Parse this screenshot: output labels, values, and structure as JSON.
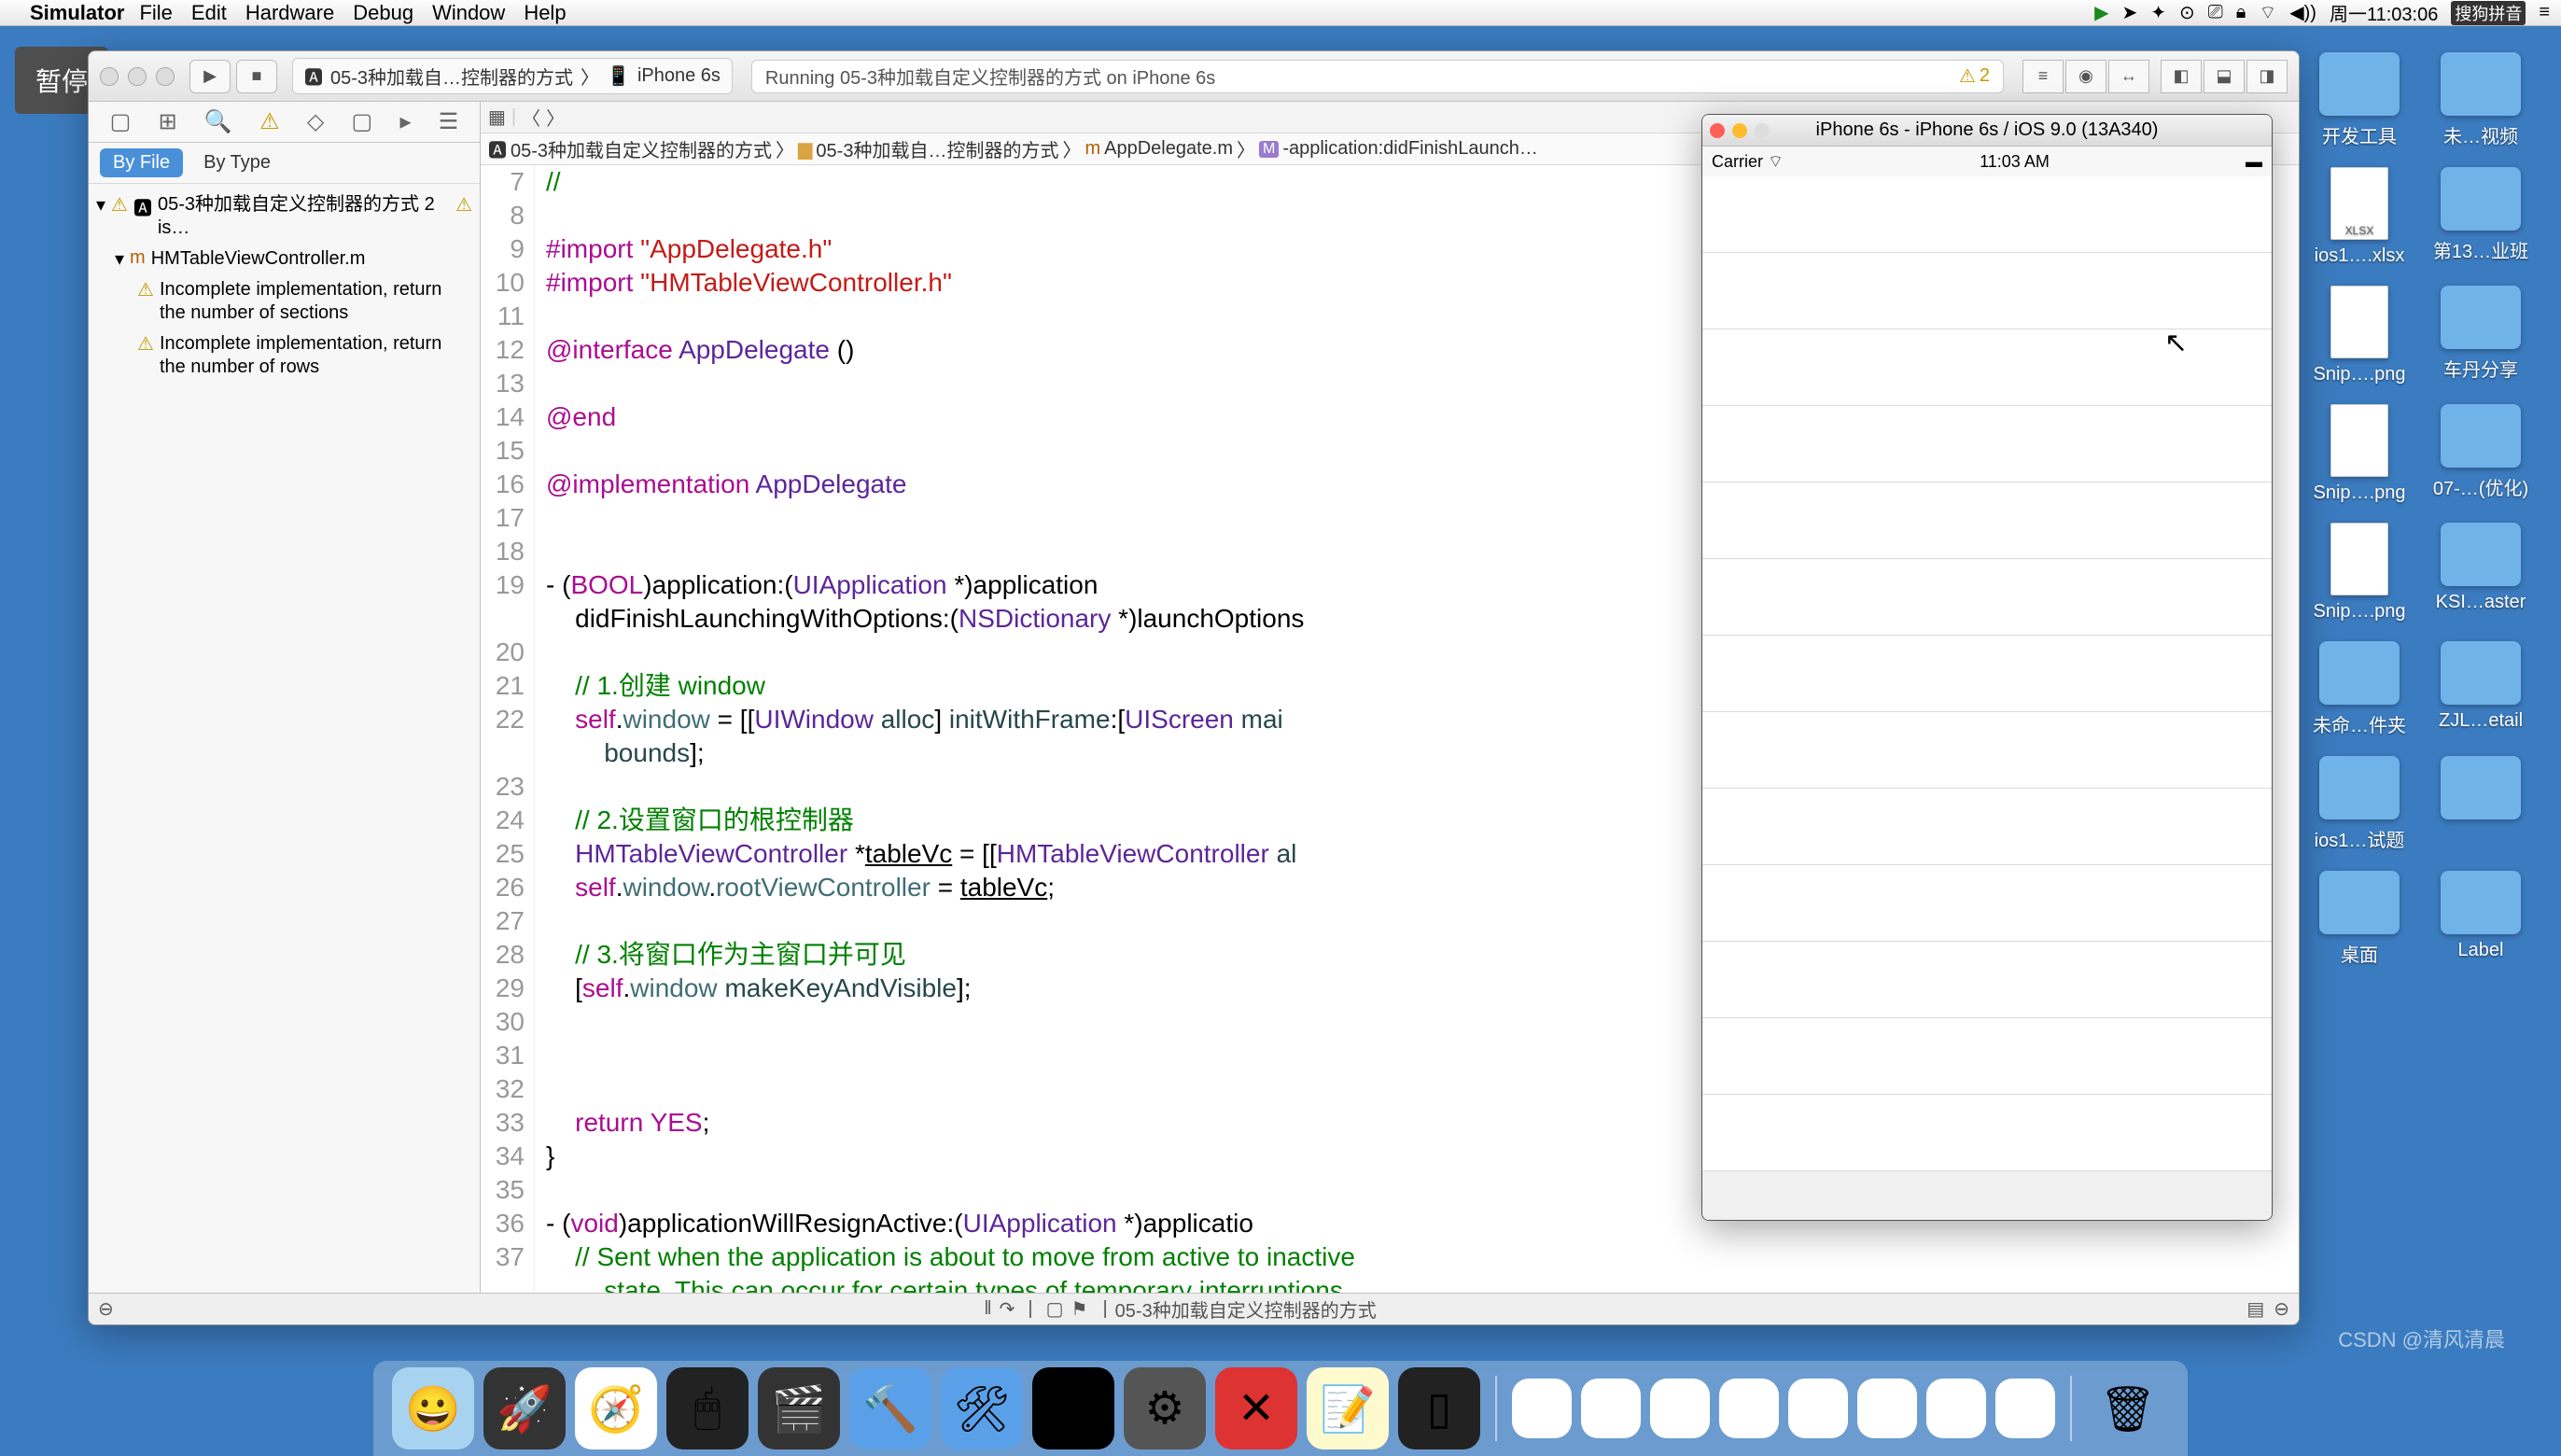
{
  "menubar": {
    "app": "Simulator",
    "menus": [
      "File",
      "Edit",
      "Hardware",
      "Debug",
      "Window",
      "Help"
    ],
    "clock": "周一11:03:06",
    "ime": "搜狗拼音"
  },
  "pause": "暂停",
  "xcode": {
    "scheme_project": "05-3种加载自…控制器的方式",
    "scheme_device": "iPhone 6s",
    "status": "Running 05-3种加载自定义控制器的方式 on iPhone 6s",
    "warn_count": "2",
    "navigator": {
      "filter_byfile": "By File",
      "filter_bytype": "By Type",
      "root": "05-3种加载自定义控制器的方式 2 is…",
      "file": "HMTableViewController.m",
      "issue1": "Incomplete implementation, return the number of sections",
      "issue2": "Incomplete implementation, return the number of rows"
    },
    "breadcrumb": {
      "b1": "05-3种加载自定义控制器的方式",
      "b2": "05-3种加载自…控制器的方式",
      "b3": "AppDelegate.m",
      "b4": "-application:didFinishLaunch…"
    },
    "code": {
      "lines": [
        {
          "n": 7,
          "html": "<span class='c-comment'>//</span>"
        },
        {
          "n": 8,
          "html": ""
        },
        {
          "n": 9,
          "html": "<span class='c-keyword'>#import</span> <span class='c-string'>\"AppDelegate.h\"</span>"
        },
        {
          "n": 10,
          "html": "<span class='c-keyword'>#import</span> <span class='c-string'>\"HMTableViewController.h\"</span>"
        },
        {
          "n": 11,
          "html": ""
        },
        {
          "n": 12,
          "html": "<span class='c-keyword'>@interface</span> <span class='c-type'>AppDelegate</span> ()"
        },
        {
          "n": 13,
          "html": ""
        },
        {
          "n": 14,
          "html": "<span class='c-keyword'>@end</span>"
        },
        {
          "n": 15,
          "html": ""
        },
        {
          "n": 16,
          "html": "<span class='c-keyword'>@implementation</span> <span class='c-type'>AppDelegate</span>"
        },
        {
          "n": 17,
          "html": ""
        },
        {
          "n": 18,
          "html": ""
        },
        {
          "n": 19,
          "html": "- (<span class='c-keyword'>BOOL</span>)application:(<span class='c-type'>UIApplication</span> *)application"
        },
        {
          "n": "",
          "html": "    didFinishLaunchingWithOptions:(<span class='c-type'>NSDictionary</span> *)launchOptions"
        },
        {
          "n": 20,
          "html": ""
        },
        {
          "n": 21,
          "html": "    <span class='c-comment'>// 1.创建 window</span>"
        },
        {
          "n": 22,
          "html": "    <span class='c-self'>self</span>.<span class='c-prop'>window</span> = [[<span class='c-type'>UIWindow</span> <span class='c-method'>alloc</span>] <span class='c-method'>initWithFrame</span>:[<span class='c-type'>UIScreen</span> <span class='c-method'>mai</span>"
        },
        {
          "n": "",
          "html": "        <span class='c-method'>bounds</span>];"
        },
        {
          "n": 23,
          "html": ""
        },
        {
          "n": 24,
          "html": "    <span class='c-comment'>// 2.设置窗口的根控制器</span>"
        },
        {
          "n": 25,
          "html": "    <span class='c-type'>HMTableViewController</span> *<u>tableVc</u> = [[<span class='c-type'>HMTableViewController</span> <span class='c-method'>al</span>"
        },
        {
          "n": 26,
          "html": "    <span class='c-self'>self</span>.<span class='c-prop'>window</span>.<span class='c-prop'>rootViewController</span> = <u>tableVc</u>;"
        },
        {
          "n": 27,
          "html": ""
        },
        {
          "n": 28,
          "html": "    <span class='c-comment'>// 3.将窗口作为主窗口并可见</span>"
        },
        {
          "n": 29,
          "html": "    [<span class='c-self'>self</span>.<span class='c-prop'>window</span> <span class='c-method'>makeKeyAndVisible</span>];"
        },
        {
          "n": 30,
          "html": ""
        },
        {
          "n": 31,
          "html": ""
        },
        {
          "n": 32,
          "html": ""
        },
        {
          "n": 33,
          "html": "    <span class='c-keyword'>return</span> <span class='c-yes'>YES</span>;"
        },
        {
          "n": 34,
          "html": "}"
        },
        {
          "n": 35,
          "html": ""
        },
        {
          "n": 36,
          "html": "- (<span class='c-keyword'>void</span>)applicationWillResignActive:(<span class='c-type'>UIApplication</span> *)applicatio"
        },
        {
          "n": 37,
          "html": "    <span class='c-comment'>// Sent when the application is about to move from active to inactive</span>"
        },
        {
          "n": "",
          "html": "        <span class='c-comment'>state. This can occur for certain types of temporary interruptions</span>"
        }
      ]
    },
    "footer_path": "05-3种加载自定义控制器的方式"
  },
  "simulator": {
    "title": "iPhone 6s - iPhone 6s / iOS 9.0 (13A340)",
    "carrier": "Carrier",
    "time": "11:03 AM"
  },
  "desktop": {
    "items": [
      {
        "label": "开发工具",
        "type": "folder"
      },
      {
        "label": "未…视频",
        "type": "folder"
      },
      {
        "label": "ios1….xlsx",
        "type": "xlsx"
      },
      {
        "label": "第13…业班",
        "type": "folder"
      },
      {
        "label": "Snip….png",
        "type": "png"
      },
      {
        "label": "车丹分享",
        "type": "folder"
      },
      {
        "label": "Snip….png",
        "type": "png"
      },
      {
        "label": "07-…(优化)",
        "type": "folder"
      },
      {
        "label": "Snip….png",
        "type": "png"
      },
      {
        "label": "KSI…aster",
        "type": "folder"
      },
      {
        "label": "未命…件夹",
        "type": "folder"
      },
      {
        "label": "ZJL…etail",
        "type": "folder"
      },
      {
        "label": "ios1…试题",
        "type": "folder"
      },
      {
        "label": "",
        "type": "folder"
      },
      {
        "label": "桌面",
        "type": "folder"
      },
      {
        "label": "Label",
        "type": "folder"
      }
    ]
  },
  "dock": {
    "apps": [
      "finder",
      "launchpad",
      "safari",
      "mouse",
      "imovie",
      "xcode",
      "xcode2",
      "terminal",
      "settings",
      "app-red",
      "notes",
      "terminal2"
    ],
    "minimized_count": 8
  },
  "watermark": "CSDN @清风清晨"
}
